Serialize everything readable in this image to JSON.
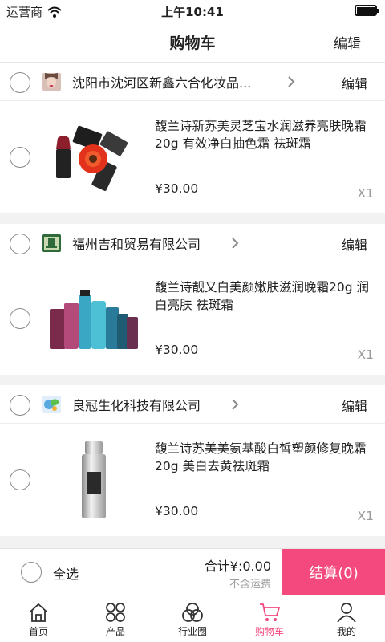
{
  "status_bar": {
    "carrier": "运营商",
    "time": "上午10:41"
  },
  "header": {
    "title": "购物车",
    "edit_label": "编辑"
  },
  "stores": [
    {
      "name": "沈阳市沈河区新鑫六合化妆品...",
      "edit_label": "编辑",
      "item": {
        "name": "馥兰诗新苏美灵芝宝水润滋养亮肤晚霜20g 有效净白抽色霜 祛斑霜",
        "price": "¥30.00",
        "qty": "X1"
      }
    },
    {
      "name": "福州吉和贸易有限公司",
      "edit_label": "编辑",
      "item": {
        "name": "馥兰诗靓又白美颜嫩肤滋润晚霜20g 润白亮肤 祛斑霜",
        "price": "¥30.00",
        "qty": "X1"
      }
    },
    {
      "name": "良冠生化科技有限公司",
      "edit_label": "编辑",
      "item": {
        "name": "馥兰诗苏美美氨基酸白皙塑颜修复晚霜20g 美白去黄祛斑霜",
        "price": "¥30.00",
        "qty": "X1"
      }
    }
  ],
  "footer": {
    "select_all": "全选",
    "total": "合计¥:0.00",
    "shipping_note": "不含运费",
    "checkout_label": "结算(0)"
  },
  "tabs": [
    {
      "label": "首页",
      "icon": "home-icon"
    },
    {
      "label": "产品",
      "icon": "grid-icon"
    },
    {
      "label": "行业圈",
      "icon": "circles-icon"
    },
    {
      "label": "购物车",
      "icon": "cart-icon",
      "active": true
    },
    {
      "label": "我的",
      "icon": "person-icon"
    }
  ],
  "colors": {
    "accent": "#f4497e",
    "muted": "#9a9a9a"
  }
}
